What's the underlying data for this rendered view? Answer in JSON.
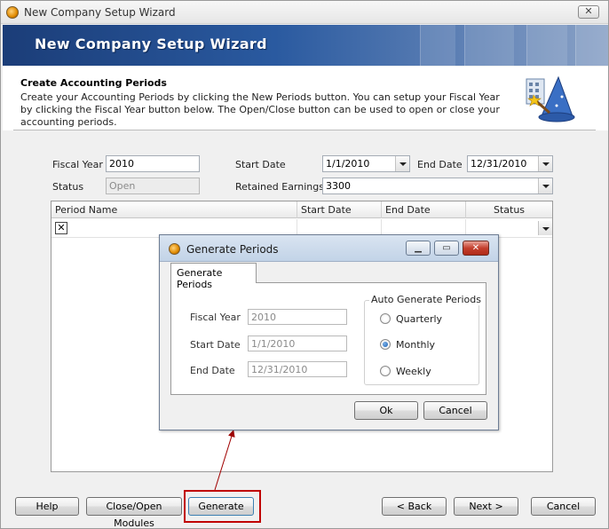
{
  "window": {
    "title": "New Company Setup Wizard",
    "close_glyph": "✕"
  },
  "banner": {
    "title": "New Company Setup Wizard"
  },
  "header": {
    "section_title": "Create Accounting Periods",
    "description": "Create your Accounting Periods by clicking the New Periods button. You can setup your Fiscal Year by clicking the Fiscal Year button below. The Open/Close button can be used to open or close your accounting periods."
  },
  "form": {
    "fiscal_year_label": "Fiscal Year",
    "fiscal_year_value": "2010",
    "status_label": "Status",
    "status_value": "Open",
    "start_date_label": "Start Date",
    "start_date_value": "1/1/2010",
    "end_date_label": "End Date",
    "end_date_value": "12/31/2010",
    "retained_earnings_label": "Retained Earnings",
    "retained_earnings_value": "3300"
  },
  "grid": {
    "columns": [
      "Period Name",
      "Start Date",
      "End Date",
      "Status"
    ],
    "row_delete_glyph": "✕"
  },
  "buttons": {
    "help": "Help",
    "close_open_modules": "Close/Open Modules",
    "generate": "Generate",
    "back": "< Back",
    "next": "Next >",
    "cancel": "Cancel"
  },
  "dialog": {
    "title": "Generate Periods",
    "tab_label": "Generate Periods",
    "fiscal_year_label": "Fiscal Year",
    "fiscal_year_value": "2010",
    "start_date_label": "Start Date",
    "start_date_value": "1/1/2010",
    "end_date_label": "End Date",
    "end_date_value": "12/31/2010",
    "group_title": "Auto Generate Periods",
    "options": [
      "Quarterly",
      "Monthly",
      "Weekly"
    ],
    "selected_option": "Monthly",
    "ok": "Ok",
    "cancel": "Cancel",
    "minimize_glyph": "▁",
    "maximize_glyph": "▭",
    "close_glyph": "✕"
  },
  "colors": {
    "banner": "#2a5aa0",
    "highlight": "#c00000",
    "arrow": "#a00000"
  }
}
